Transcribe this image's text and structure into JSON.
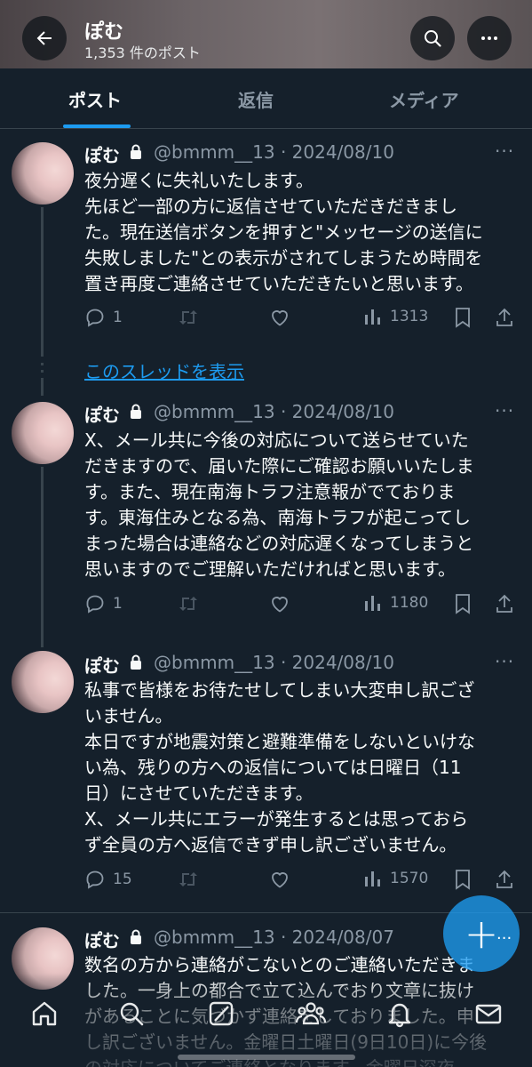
{
  "header": {
    "title": "ぽむ",
    "post_count": "1,353 件のポスト"
  },
  "tabs": [
    {
      "label": "ポスト"
    },
    {
      "label": "返信"
    },
    {
      "label": "メディア"
    }
  ],
  "show_thread_label": "このスレッドを表示",
  "posts": [
    {
      "name": "ぽむ",
      "handle_date": "@bmmm__13 · 2024/08/10",
      "text": "夜分遅くに失礼いたします。\n先ほど一部の方に返信させていただきだきまし\nた。現在送信ボタンを押すと\"メッセージの送信に\n失敗しました\"との表示がされてしまうため時間を\n置き再度ご連絡させていただきたいと思います。",
      "replies": "1",
      "views": "1313"
    },
    {
      "name": "ぽむ",
      "handle_date": "@bmmm__13 · 2024/08/10",
      "text": "X、メール共に今後の対応について送らせていた\nだきますので、届いた際にご確認お願いいたしま\nす。また、現在南海トラフ注意報がでておりま\nす。東海住みとなる為、南海トラフが起こってし\nまった場合は連絡などの対応遅くなってしまうと\n思いますのでご理解いただければと思います。",
      "replies": "1",
      "views": "1180"
    },
    {
      "name": "ぽむ",
      "handle_date": "@bmmm__13 · 2024/08/10",
      "text": "私事で皆様をお待たせしてしまい大変申し訳ござ\nいません。\n本日ですが地震対策と避難準備をしないといけな\nい為、残りの方への返信については日曜日（11\n日）にさせていただきます。\nX、メール共にエラーが発生するとは思っておら\nず全員の方へ返信できず申し訳ございません。",
      "replies": "15",
      "views": "1570"
    },
    {
      "name": "ぽむ",
      "handle_date": "@bmmm__13 · 2024/08/07",
      "text": "数名の方から連絡がこないとのご連絡いただきま\nした。一身上の都合で立て込んでおり文章に抜け\nがあることに気づかず連絡をしておりました。申\nし訳ございません。金曜日土曜日(9日10日)に今後\nの対応についてご連絡となります。金曜日深夜"
    }
  ],
  "colors": {
    "background": "#15202b",
    "accent": "#1d9bf0",
    "secondary_text": "#8b98a5"
  }
}
